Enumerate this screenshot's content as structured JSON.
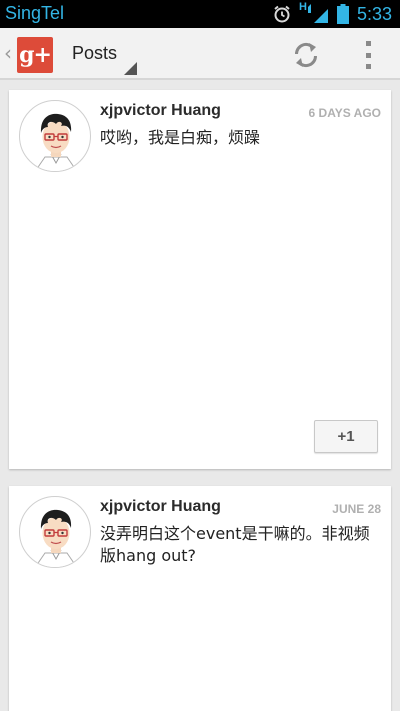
{
  "status_bar": {
    "carrier": "SingTel",
    "network_type": "H",
    "time": "5:33"
  },
  "action_bar": {
    "title": "Posts"
  },
  "posts": [
    {
      "author": "xjpvictor Huang",
      "time": "6 DAYS AGO",
      "content": "哎哟，我是白痴，烦躁",
      "plus_one_label": "+1"
    },
    {
      "author": "xjpvictor Huang",
      "time": "JUNE 28",
      "content": "没弄明白这个event是干嘛的。非视频版hang out?"
    }
  ],
  "colors": {
    "status_accent": "#33b5e5",
    "gplus_red": "#dd4b39",
    "timestamp_gray": "#b0b0b0"
  }
}
